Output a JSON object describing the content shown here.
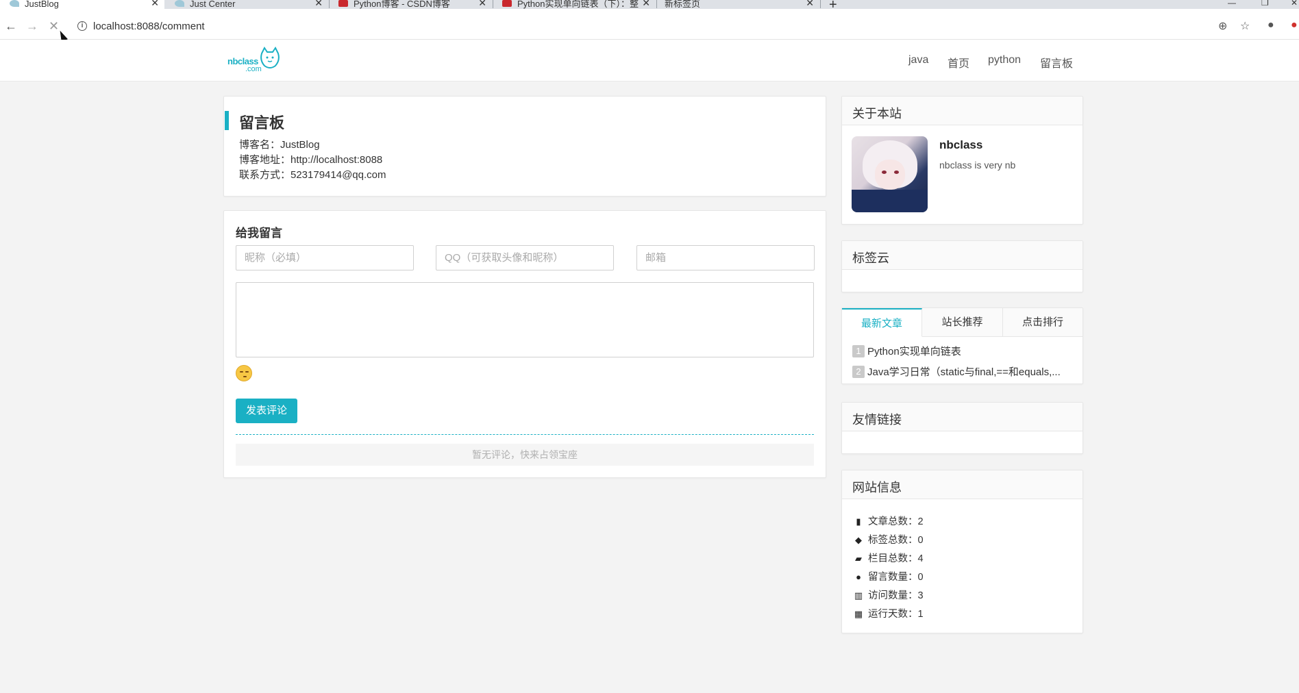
{
  "browser": {
    "tabs": [
      {
        "title": "JustBlog",
        "active": true
      },
      {
        "title": "Just Center",
        "active": false
      },
      {
        "title": "Python博客 - CSDN博客",
        "active": false
      },
      {
        "title": "Python实现单向链表（下）：整",
        "active": false
      },
      {
        "title": "新标签页",
        "active": false
      }
    ],
    "url": "localhost:8088/comment"
  },
  "site": {
    "logo_text": "nbclass",
    "logo_suffix": ".com",
    "nav": [
      "java",
      "首页",
      "python",
      "留言板"
    ]
  },
  "board": {
    "title": "留言板",
    "blog_name": "博客名：JustBlog",
    "blog_url": "博客地址：http://localhost:8088",
    "contact": "联系方式：523179414@qq.com"
  },
  "comment_form": {
    "title": "给我留言",
    "nickname_placeholder": "昵称（必填）",
    "qq_placeholder": "QQ（可获取头像和昵称）",
    "email_placeholder": "邮箱",
    "submit_label": "发表评论",
    "empty_text": "暂无评论，快来占领宝座"
  },
  "sidebar": {
    "about": {
      "title": "关于本站",
      "name": "nbclass",
      "desc": "nbclass is very nb"
    },
    "tags": {
      "title": "标签云"
    },
    "tabs": [
      "最新文章",
      "站长推荐",
      "点击排行"
    ],
    "articles": [
      {
        "num": "1",
        "title": "Python实现单向链表"
      },
      {
        "num": "2",
        "title": "Java学习日常（static与final,==和equals,..."
      }
    ],
    "links": {
      "title": "友情链接"
    },
    "stats": {
      "title": "网站信息",
      "items": [
        {
          "icon": "file-icon",
          "label": "文章总数：2"
        },
        {
          "icon": "tags-icon",
          "label": "标签总数：0"
        },
        {
          "icon": "folder-open-icon",
          "label": "栏目总数：4"
        },
        {
          "icon": "comments-icon",
          "label": "留言数量：0"
        },
        {
          "icon": "bar-chart-icon",
          "label": "访问数量：3"
        },
        {
          "icon": "calendar-icon",
          "label": "运行天数：1"
        }
      ]
    }
  },
  "colors": {
    "accent": "#1ab0c4",
    "background": "#f3f3f3"
  }
}
